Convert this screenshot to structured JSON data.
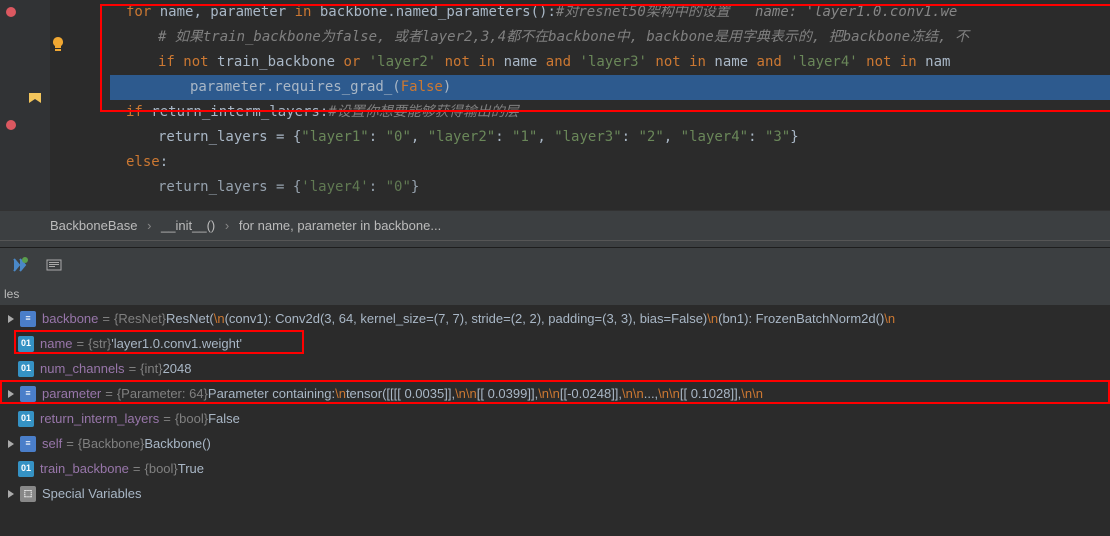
{
  "code": {
    "line1_for": "for",
    "line1_name": " name, parameter ",
    "line1_in": "in",
    "line1_call": " backbone.named_parameters():",
    "line1_comment": "#对resnet50架构中的设置",
    "line1_hint": "name: 'layer1.0.conv1.we",
    "line2_comment": "# 如果train_backbone为false, 或者layer2,3,4都不在backbone中, backbone是用字典表示的, 把backbone冻结, 不",
    "line3_if": "if",
    "line3_not1": "not",
    "line3_tb": " train_backbone ",
    "line3_or": "or",
    "line3_l2": "'layer2'",
    "line3_not2": "not in",
    "line3_name1": " name ",
    "line3_and1": "and",
    "line3_l3": "'layer3'",
    "line3_not3": "not in",
    "line3_name2": " name ",
    "line3_and2": "and",
    "line3_l4": "'layer4'",
    "line3_not4": "not in",
    "line3_name3": " nam",
    "line4_call": "parameter.requires_grad_(",
    "line4_false": "False",
    "line4_close": ")",
    "line5_if": "if",
    "line5_var": " return_interm_layers:",
    "line5_comment": "#设置你想要能够获得输出的层",
    "line6_var": "return_layers = {",
    "line6_k1": "\"layer1\"",
    "line6_v1": "\"0\"",
    "line6_k2": "\"layer2\"",
    "line6_v2": "\"1\"",
    "line6_k3": "\"layer3\"",
    "line6_v3": "\"2\"",
    "line6_k4": "\"layer4\"",
    "line6_v4": "\"3\"",
    "line7_else": "else",
    "line8_var": "return_layers = {",
    "line8_k": "'layer4'",
    "line8_v": "\"0\""
  },
  "breadcrumb": {
    "item1": "BackboneBase",
    "item2": "__init__()",
    "item3": "for name, parameter in backbone..."
  },
  "variables_header": "les",
  "vars": {
    "backbone": {
      "name": "backbone",
      "type": "{ResNet}",
      "value_pre": " ResNet(",
      "value_esc1": "\\n",
      "value_mid": "  (conv1): Conv2d(3, 64, kernel_size=(7, 7), stride=(2, 2), padding=(3, 3), bias=False)",
      "value_esc2": "\\n",
      "value_end": "  (bn1): FrozenBatchNorm2d()",
      "value_esc3": "\\n"
    },
    "name": {
      "name": "name",
      "type": "{str}",
      "value": " 'layer1.0.conv1.weight'"
    },
    "num_channels": {
      "name": "num_channels",
      "type": "{int}",
      "value": " 2048"
    },
    "parameter": {
      "name": "parameter",
      "type": "{Parameter: 64}",
      "value_pre": " Parameter containing:",
      "esc_n": "\\n",
      "tensor_start": "tensor([[[[ 0.0035]],",
      "esc_nn": "\\n\\n",
      "t2": "         [[ 0.0399]],",
      "t3": "         [[-0.0248]],",
      "dots": "         ...,",
      "t4": "         [[ 0.1028]],"
    },
    "return_interm": {
      "name": "return_interm_layers",
      "type": "{bool}",
      "value": " False"
    },
    "self": {
      "name": "self",
      "type": "{Backbone}",
      "value": " Backbone()"
    },
    "train_backbone": {
      "name": "train_backbone",
      "type": "{bool}",
      "value": " True"
    },
    "special": {
      "name": "Special Variables"
    }
  }
}
